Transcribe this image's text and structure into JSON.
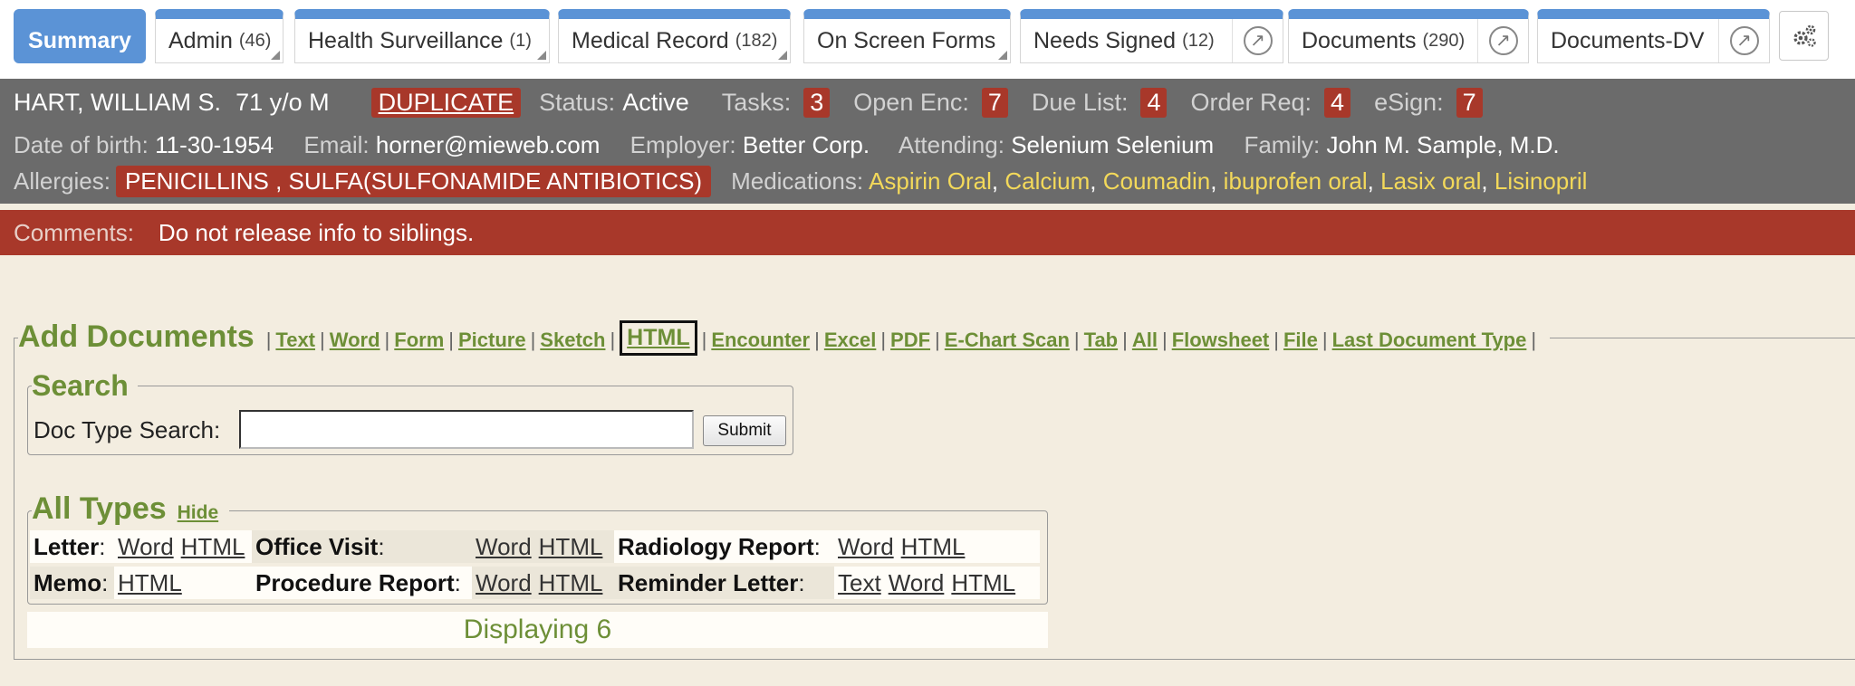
{
  "tabs": [
    {
      "label": "Summary",
      "count": ""
    },
    {
      "label": "Admin",
      "count": "(46)"
    },
    {
      "label": "Health Surveillance",
      "count": "(1)"
    },
    {
      "label": "Medical Record",
      "count": "(182)"
    },
    {
      "label": "On Screen Forms",
      "count": ""
    },
    {
      "label": "Needs Signed",
      "count": "(12)"
    },
    {
      "label": "Documents",
      "count": "(290)"
    },
    {
      "label": "Documents-DV",
      "count": ""
    }
  ],
  "patient": {
    "name": "HART, WILLIAM S.",
    "age_sex": "71 y/o M",
    "duplicate": "DUPLICATE",
    "status_label": "Status:",
    "status": "Active",
    "tasks_label": "Tasks:",
    "tasks": "3",
    "open_enc_label": "Open Enc:",
    "open_enc": "7",
    "due_list_label": "Due List:",
    "due_list": "4",
    "order_req_label": "Order Req:",
    "order_req": "4",
    "esign_label": "eSign:",
    "esign": "7",
    "dob_label": "Date of birth:",
    "dob": "11-30-1954",
    "email_label": "Email:",
    "email": "horner@mieweb.com",
    "employer_label": "Employer:",
    "employer": "Better Corp.",
    "attending_label": "Attending:",
    "attending": "Selenium Selenium",
    "family_label": "Family:",
    "family": "John M. Sample, M.D.",
    "allergies_label": "Allergies:",
    "allergies": "PENICILLINS , SULFA(SULFONAMIDE ANTIBIOTICS)",
    "medications_label": "Medications:",
    "medications": [
      "Aspirin Oral",
      "Calcium",
      "Coumadin",
      "ibuprofen oral",
      "Lasix oral",
      "Lisinopril"
    ]
  },
  "comments": {
    "label": "Comments:",
    "text": "Do not release info to siblings."
  },
  "add_documents": {
    "title": "Add Documents",
    "links": [
      "Text",
      "Word",
      "Form",
      "Picture",
      "Sketch",
      "HTML",
      "Encounter",
      "Excel",
      "PDF",
      "E-Chart Scan",
      "Tab",
      "All",
      "Flowsheet",
      "File",
      "Last Document Type"
    ]
  },
  "search": {
    "title": "Search",
    "label": "Doc Type Search:",
    "value": "",
    "submit": "Submit"
  },
  "all_types": {
    "title": "All Types",
    "hide": "Hide",
    "rows": [
      [
        {
          "name": "Letter",
          "links": [
            "Word",
            "HTML"
          ]
        },
        {
          "name": "Office Visit",
          "links": [
            "Word",
            "HTML"
          ]
        },
        {
          "name": "Radiology Report",
          "links": [
            "Word",
            "HTML"
          ]
        }
      ],
      [
        {
          "name": "Memo",
          "links": [
            "HTML"
          ]
        },
        {
          "name": "Procedure Report",
          "links": [
            "Word",
            "HTML"
          ]
        },
        {
          "name": "Reminder Letter",
          "links": [
            "Text",
            "Word",
            "HTML"
          ]
        }
      ]
    ],
    "displaying": "Displaying 6"
  },
  "colors": {
    "tab_accent": "#5b93d6",
    "patient_bar": "#6b6b6b",
    "alert_red": "#a8382a",
    "link_green": "#6d8f37",
    "medication_yellow": "#f3d95a",
    "page_bg": "#f3ede0"
  },
  "icons": {
    "popout": "arrow-up-right-circle-icon",
    "settings": "gears-icon",
    "resize": "resize-corner-icon"
  }
}
